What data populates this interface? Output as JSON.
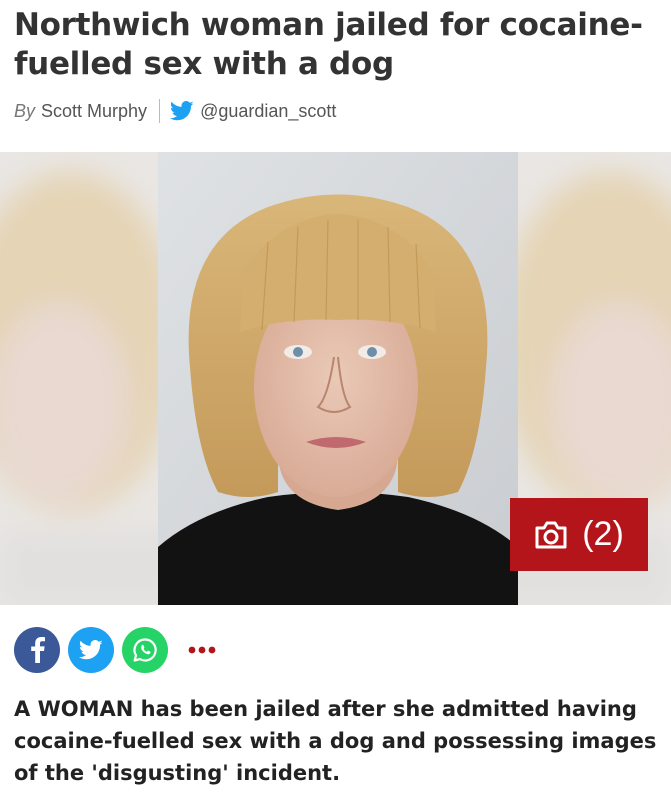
{
  "article": {
    "headline": "Northwich woman jailed for cocaine-fuelled sex with a dog",
    "byline": {
      "prefix": "By",
      "author": "Scott Murphy",
      "twitter_handle": "@guardian_scott"
    },
    "intro": "A WOMAN has been jailed after she admitted having cocaine-fuelled sex with a dog and possessing images of the 'disgusting' incident."
  },
  "gallery": {
    "count_label": "(2)",
    "icon": "camera-icon"
  },
  "share": {
    "buttons": [
      {
        "network": "facebook",
        "icon": "facebook-icon",
        "color": "#3b5998"
      },
      {
        "network": "twitter",
        "icon": "twitter-icon",
        "color": "#1da1f2"
      },
      {
        "network": "whatsapp",
        "icon": "whatsapp-icon",
        "color": "#25d366"
      }
    ],
    "more_icon": "more-dots-icon",
    "more_color": "#b3151b"
  },
  "colors": {
    "accent": "#b3151b",
    "twitter": "#1da1f2",
    "headline": "#333333"
  }
}
